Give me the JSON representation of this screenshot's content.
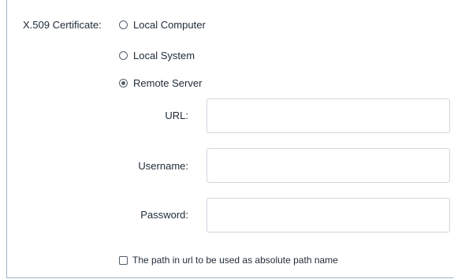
{
  "certificate": {
    "label": "X.509 Certificate:",
    "options": [
      {
        "label": "Local Computer",
        "selected": false
      },
      {
        "label": "Local System",
        "selected": false
      },
      {
        "label": "Remote Server",
        "selected": true
      }
    ]
  },
  "remote": {
    "url_label": "URL:",
    "url_value": "",
    "username_label": "Username:",
    "username_value": "",
    "password_label": "Password:",
    "password_value": ""
  },
  "absolute_path": {
    "label": "The path in url to be used as absolute path name",
    "checked": false
  }
}
